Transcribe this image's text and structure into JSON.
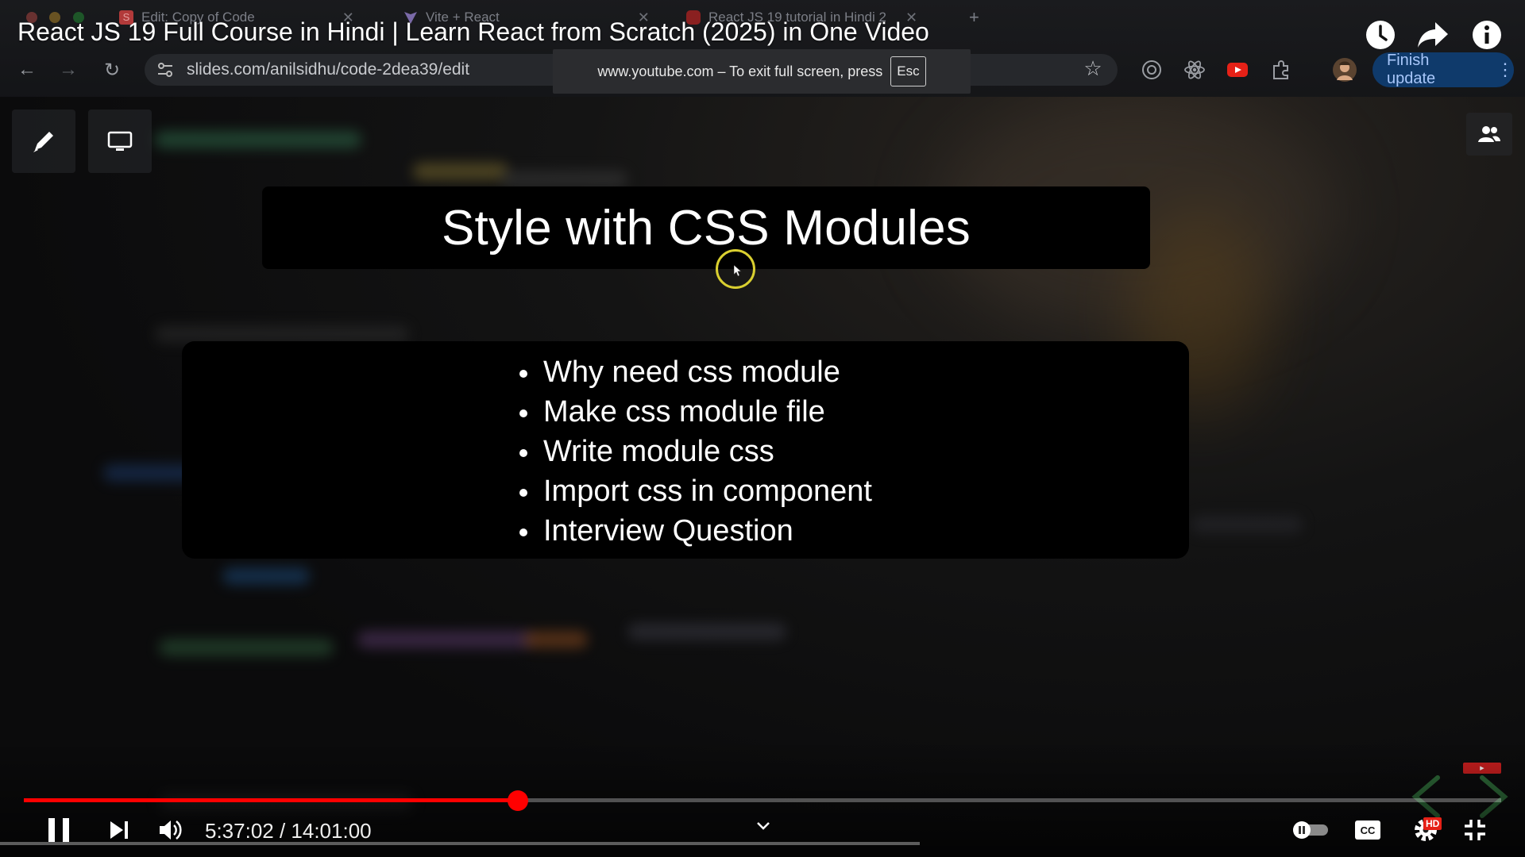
{
  "video": {
    "title": "React JS 19 Full Course in Hindi | Learn React from Scratch (2025) in One Video",
    "current_time": "5:37:02",
    "duration": "14:01:00",
    "time_display": "5:37:02 / 14:01:00",
    "progress_fraction": 0.3345,
    "hd_badge": "HD"
  },
  "browser": {
    "tabs": [
      {
        "label": "Edit: Copy of Code",
        "favicon": "S"
      },
      {
        "label": "Vite + React"
      },
      {
        "label": "React JS 19 tutorial in Hindi 2"
      }
    ],
    "new_tab_symbol": "+",
    "url": "slides.com/anilsidhu/code-2dea39/edit",
    "fullscreen_notice": "www.youtube.com – To exit full screen, press",
    "esc_key": "Esc",
    "finish_update_label": "Finish update"
  },
  "slide": {
    "title": "Style with CSS Modules",
    "bullets": [
      "Why need css module",
      "Make css module file",
      "Write module css",
      "Import css in component",
      "Interview Question"
    ]
  },
  "colors": {
    "progress": "#ff0000",
    "cursor_ring": "#d9cf30",
    "finish_update_bg": "#0f3a6b",
    "finish_update_text": "#a8c7fa"
  },
  "icons": {
    "top_right": [
      "watch-later-icon",
      "share-icon",
      "info-icon"
    ],
    "controls": [
      "pause-icon",
      "next-icon",
      "volume-icon",
      "chevron-down-icon",
      "autoplay-toggle",
      "captions-icon",
      "settings-icon",
      "exit-fullscreen-icon"
    ]
  }
}
